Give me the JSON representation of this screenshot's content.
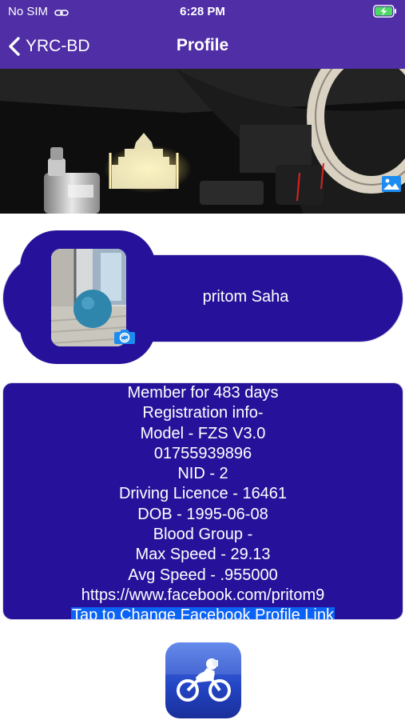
{
  "status_bar": {
    "carrier": "No SIM",
    "time": "6:28 PM"
  },
  "nav": {
    "back_label": "YRC-BD",
    "title": "Profile"
  },
  "profile": {
    "name": "pritom Saha"
  },
  "info": {
    "member_for": "Member for 483 days",
    "registration_header": "Registration info-",
    "model": "Model - FZS V3.0",
    "phone": "01755939896",
    "nid": "NID - 2",
    "driving_licence": "Driving Licence - 16461",
    "dob": "DOB - 1995-06-08",
    "blood_group": "Blood Group -",
    "max_speed": "Max Speed - 29.13",
    "avg_speed": "Avg Speed - .955000",
    "facebook_link": "https://www.facebook.com/pritom9",
    "change_link_label": "Tap to Change Facebook Profile Link"
  },
  "colors": {
    "nav": "#4f2ea6",
    "card": "#26129a",
    "link_highlight": "#0a63f5"
  },
  "icons": {
    "link": "link-icon",
    "battery": "battery-charging-icon",
    "back": "chevron-left-icon",
    "cover_edit": "image-icon",
    "avatar_edit": "camera-icon",
    "app_logo": "motorcycle-logo"
  }
}
